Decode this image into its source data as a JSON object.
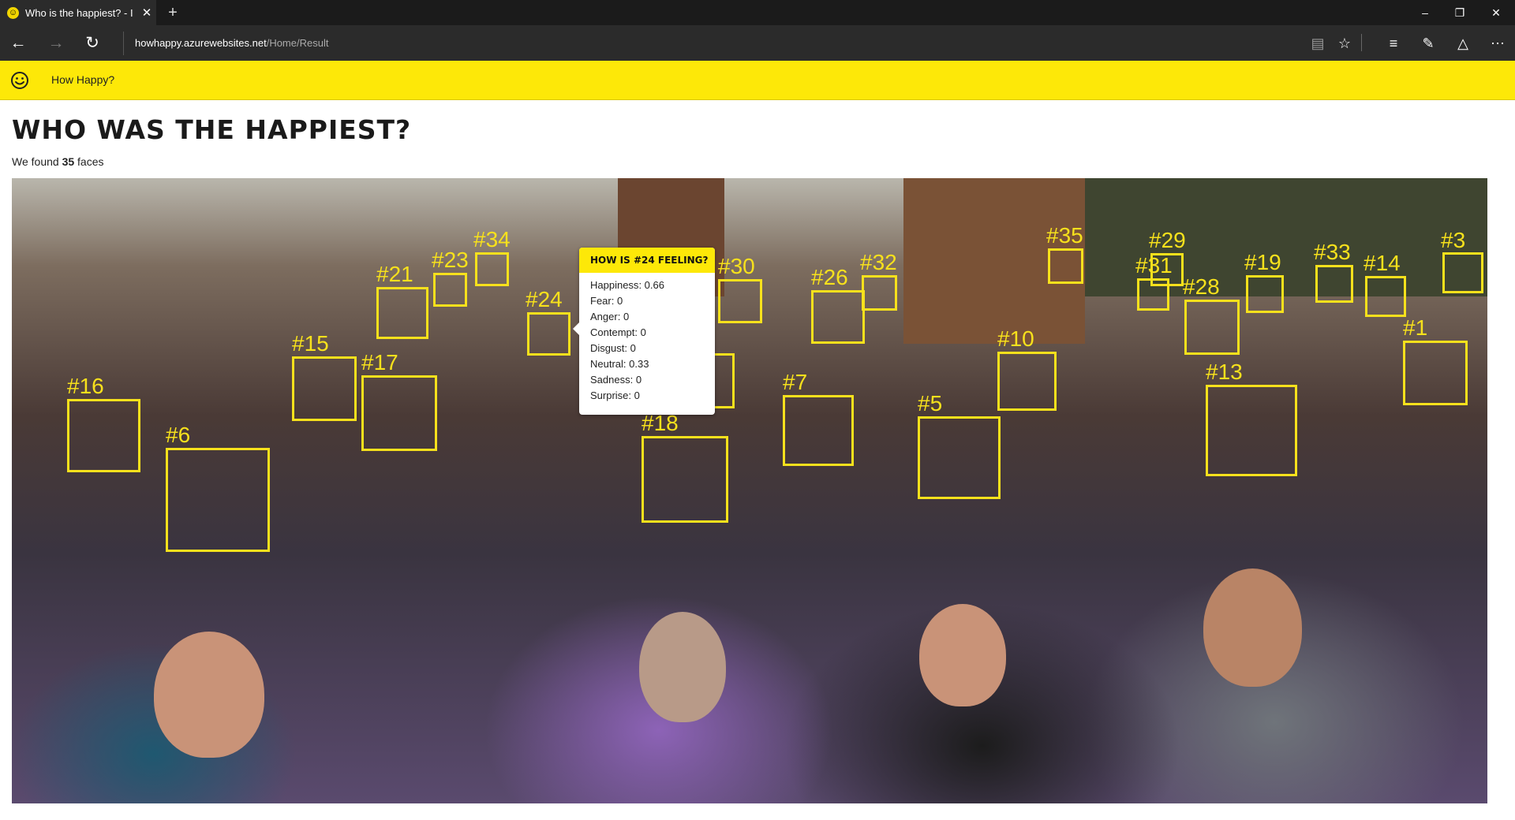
{
  "browser": {
    "tab_title": "Who is the happiest? - I",
    "tab_close": "✕",
    "new_tab": "+",
    "url_host": "howhappy.azurewebsites.net",
    "url_path": "/Home/Result"
  },
  "app": {
    "brand": "How Happy?"
  },
  "page": {
    "heading": "Who was the happiest?",
    "count_prefix": "We found ",
    "count_value": "35",
    "count_suffix": " faces"
  },
  "faces": [
    "#1",
    "#3",
    "#5",
    "#6",
    "#7",
    "#10",
    "#13",
    "#14",
    "#15",
    "#16",
    "#17",
    "#18",
    "#19",
    "#21",
    "#23",
    "#24",
    "#26",
    "#28",
    "#29",
    "#30",
    "#31",
    "#32",
    "#33",
    "#34",
    "#35"
  ],
  "tooltip": {
    "title": "How is #24 feeling?",
    "rows": [
      {
        "label": "Happiness",
        "value": "0.66"
      },
      {
        "label": "Fear",
        "value": "0"
      },
      {
        "label": "Anger",
        "value": "0"
      },
      {
        "label": "Contempt",
        "value": "0"
      },
      {
        "label": "Disgust",
        "value": "0"
      },
      {
        "label": "Neutral",
        "value": "0.33"
      },
      {
        "label": "Sadness",
        "value": "0"
      },
      {
        "label": "Surprise",
        "value": "0"
      }
    ]
  },
  "colors": {
    "accent": "#fde808",
    "box": "#f7e11c"
  }
}
